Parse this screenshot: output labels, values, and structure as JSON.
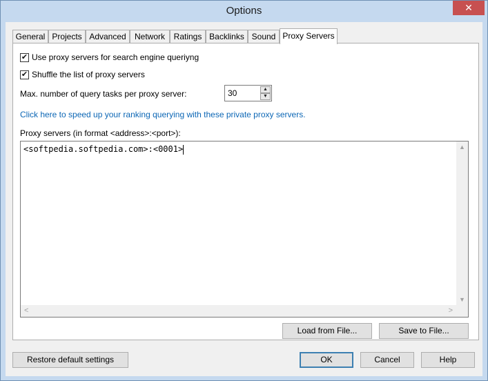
{
  "window": {
    "title": "Options",
    "close_symbol": "✕"
  },
  "tabs": [
    {
      "label": "General"
    },
    {
      "label": "Projects"
    },
    {
      "label": "Advanced"
    },
    {
      "label": "Network"
    },
    {
      "label": "Ratings"
    },
    {
      "label": "Backlinks"
    },
    {
      "label": "Sound"
    },
    {
      "label": "Proxy Servers",
      "active": true
    }
  ],
  "proxy": {
    "use_proxy": {
      "label": "Use proxy servers for search engine queriyng",
      "checked": true
    },
    "shuffle": {
      "label": "Shuffle the list of proxy servers",
      "checked": true
    },
    "max_tasks": {
      "label": "Max. number of query tasks per proxy server:",
      "value": "30"
    },
    "speed_link": "Click here to speed up your ranking querying with these private proxy servers.",
    "list_label": "Proxy servers (in format <address>:<port>):",
    "list_value": "<softpedia.softpedia.com>:<0001>",
    "load_button": "Load from File...",
    "save_button": "Save to File..."
  },
  "footer": {
    "restore_button": "Restore default settings",
    "ok_button": "OK",
    "cancel_button": "Cancel",
    "help_button": "Help"
  },
  "icons": {
    "check": "✔",
    "up": "▲",
    "down": "▼",
    "left": "<",
    "right": ">"
  }
}
